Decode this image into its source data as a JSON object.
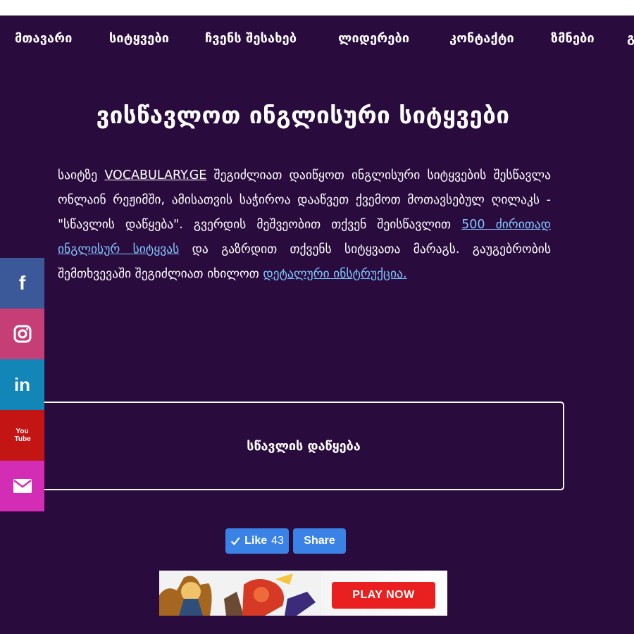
{
  "nav": {
    "items": [
      "მთავარი",
      "სიტყვები",
      "ჩვენს შესახებ",
      "ლიდერები",
      "კონტაქტი",
      "ზმნები",
      "გ"
    ]
  },
  "content": {
    "title": "ვისწავლოთ ინგლისური სიტყვები",
    "intro": {
      "p1_before_link": "საიტზე ",
      "site_link": "VOCABULARY.GE",
      "p1_after_link": " შეგიძლიათ დაიწყოთ ინგლისური სიტყვების შესწავლა ონლაინ რეჟიმში, ამისათვის საჭიროა დააწვეთ ქვემოთ მოთავსებულ ღილაკს - \"სწავლის დაწყება\". გვერდის მეშვეობით თქვენ შეისწავლით ",
      "link_500": "500 ძირითად ინგლისურ სიტყვას",
      "p1_middle": " და გაზრდით თქვენს სიტყვათა მარაგს. გაუგებრობის შემთხვევაში შეგიძლიათ იხილოთ ",
      "link_detail": "დეტალური ინსტრუქცია."
    },
    "start_button": "სწავლის დაწყება"
  },
  "social": {
    "icons": [
      "facebook-icon",
      "instagram-icon",
      "linkedin-icon",
      "youtube-icon",
      "email-icon"
    ],
    "facebook_label": "f",
    "linkedin_label": "in",
    "youtube_label": "You Tube"
  },
  "facebook_widget": {
    "like_label": "Like",
    "like_count": "43",
    "share_label": "Share"
  },
  "ad": {
    "button_label": "PLAY NOW"
  },
  "colors": {
    "background": "#2a0b3e",
    "link": "#80c7ff",
    "facebook": "#3b5998",
    "instagram": "#c63e76",
    "linkedin": "#1286b7",
    "youtube": "#c41515",
    "email": "#d22db4",
    "fb_widget": "#3b82e6",
    "ad_button": "#ea1f1f"
  }
}
